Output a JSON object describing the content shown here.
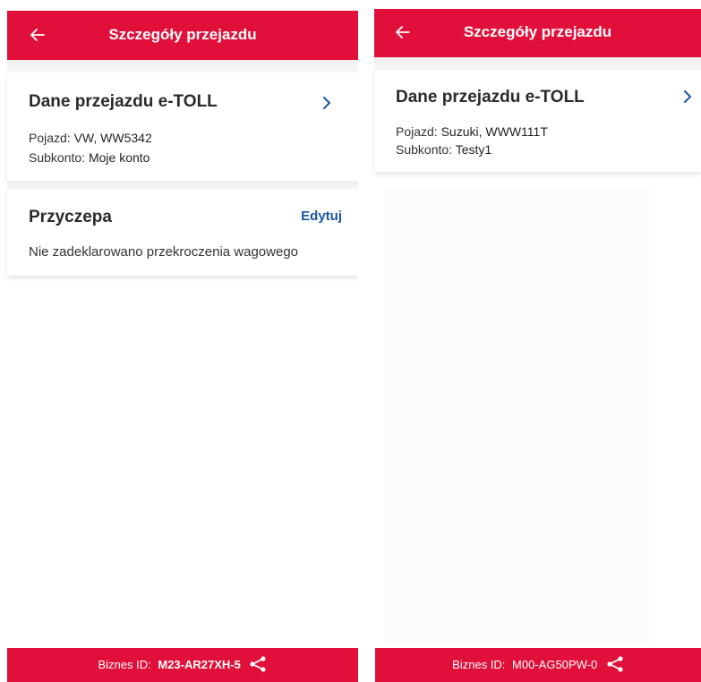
{
  "screens": [
    {
      "header": {
        "title": "Szczegóły przejazdu",
        "back_icon": "arrow-left-icon"
      },
      "trip_card": {
        "title": "Dane przejazdu e-TOLL",
        "vehicle_label": "Pojazd:",
        "vehicle_value": "VW, WW5342",
        "subaccount_label": "Subkonto:",
        "subaccount_value": "Moje konto"
      },
      "trailer_card": {
        "title": "Przyczepa",
        "edit_label": "Edytuj",
        "status_text": "Nie zadeklarowano przekroczenia wagowego"
      },
      "footer": {
        "business_id_label": "Biznes ID:",
        "business_id_value": "M23-AR27XH-5",
        "share_icon": "share-icon"
      }
    },
    {
      "header": {
        "title": "Szczegóły przejazdu",
        "back_icon": "arrow-left-icon"
      },
      "trip_card": {
        "title": "Dane przejazdu e-TOLL",
        "vehicle_label": "Pojazd:",
        "vehicle_value": "Suzuki, WWW111T",
        "subaccount_label": "Subkonto:",
        "subaccount_value": "Testy1"
      },
      "footer": {
        "business_id_label": "Biznes ID:",
        "business_id_value": "M00-AG50PW-0",
        "share_icon": "share-icon"
      }
    }
  ],
  "colors": {
    "brand_red": "#e0103a",
    "link_blue": "#1a56a6"
  }
}
